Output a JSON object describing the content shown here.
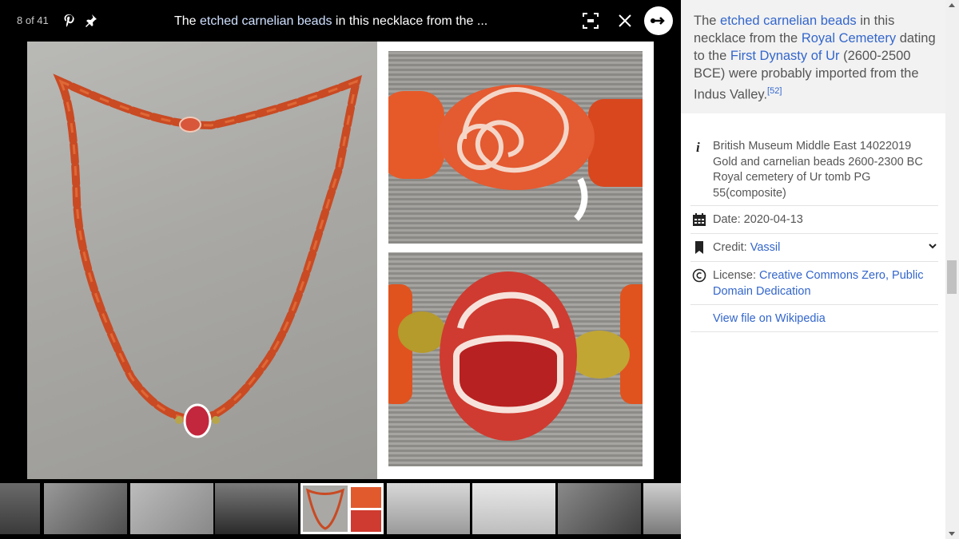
{
  "viewer": {
    "counter": "8 of 41",
    "caption_plain_1": "The ",
    "caption_link": "etched carnelian beads",
    "caption_plain_2": " in this necklace from the ...",
    "icons": {
      "pinterest": "pinterest-icon",
      "pin": "pushpin-icon",
      "fit": "fit-screen-icon",
      "close": "close-icon",
      "share": "share-icon"
    }
  },
  "description": {
    "t1": "The ",
    "l1": "etched carnelian beads",
    "t2": " in this necklace from the ",
    "l2": "Royal Cemetery",
    "t3": " dating to the ",
    "l3": "First Dynasty of Ur",
    "t4": " (2600-2500 BCE) were probably imported from the Indus Valley.",
    "ref": "[52]"
  },
  "meta": {
    "source": "British Museum Middle East 14022019 Gold and carnelian beads 2600-2300 BC Royal cemetery of Ur tomb PG 55(composite)",
    "date": "Date: 2020-04-13",
    "credit_label": "Credit: ",
    "credit_value": "Vassil",
    "license_label": "License: ",
    "license_value": "Creative Commons Zero, Public Domain Dedication",
    "view_file": "View file on Wikipedia"
  },
  "colors": {
    "link": "#3366cc",
    "panel_bg": "#f2f2f2",
    "viewer_bg": "#000000",
    "bead": "#d1451f"
  }
}
